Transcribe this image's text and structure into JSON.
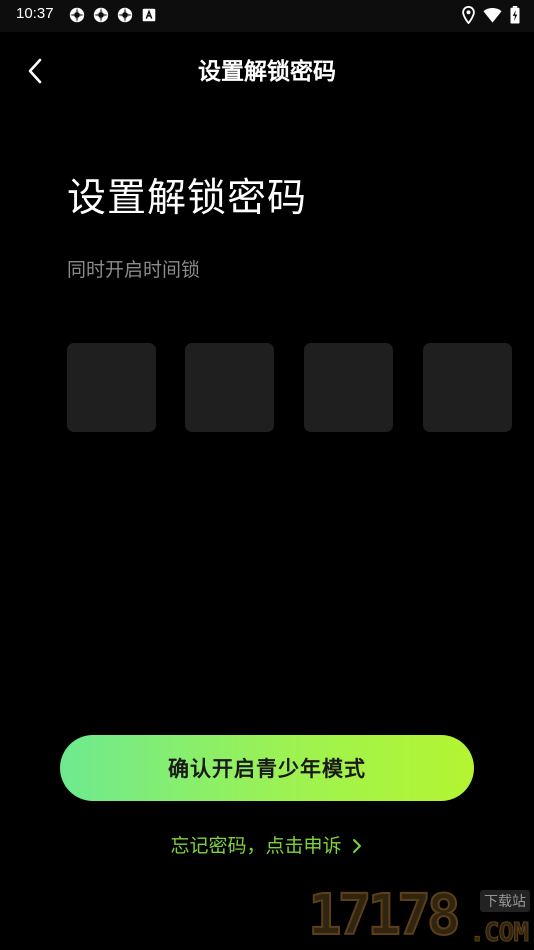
{
  "status_bar": {
    "time": "10:37",
    "left_icons": [
      "app-notification-icon",
      "app-notification-icon",
      "app-notification-icon",
      "keyboard-notification-icon"
    ],
    "right_icons": [
      "location-icon",
      "wifi-icon",
      "battery-charging-icon"
    ]
  },
  "nav": {
    "title": "设置解锁密码",
    "back_icon": "chevron-left-icon"
  },
  "main": {
    "heading": "设置解锁密码",
    "subheading": "同时开启时间锁",
    "code_boxes": [
      "",
      "",
      "",
      ""
    ]
  },
  "actions": {
    "confirm_label": "确认开启青少年模式",
    "forgot_label": "忘记密码，点击申诉",
    "forgot_icon": "chevron-right-icon"
  },
  "colors": {
    "background": "#000000",
    "code_box": "#1f1f1f",
    "button_gradient_start": "#6ee98f",
    "button_gradient_end": "#b4f531",
    "link": "#7fd33a"
  },
  "watermark": {
    "number": "17178",
    "tag": "下载站",
    "domain": ".COM"
  }
}
